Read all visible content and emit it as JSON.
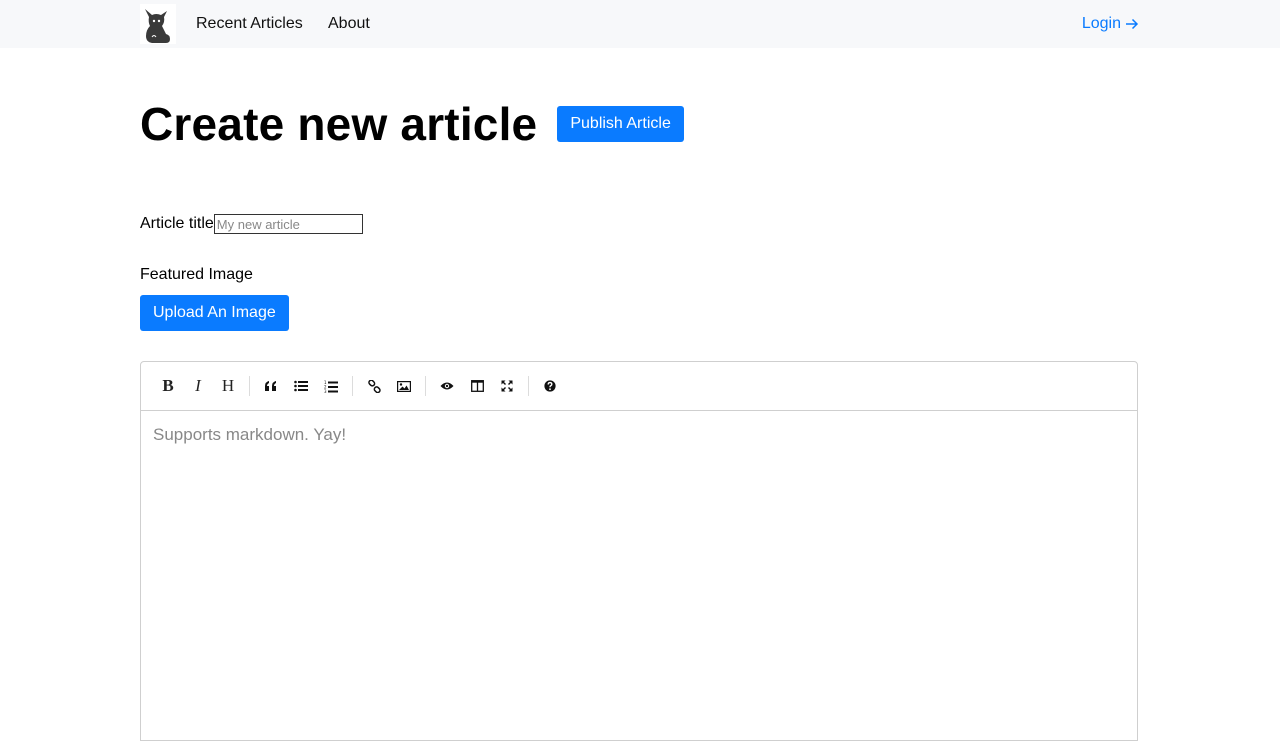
{
  "nav": {
    "logo_name": "cat-logo",
    "links": [
      "Recent Articles",
      "About"
    ],
    "login_label": "Login",
    "login_icon": "arrow-right-icon"
  },
  "page": {
    "title": "Create new article",
    "publish_label": "Publish Article"
  },
  "form": {
    "title_label": "Article title",
    "title_placeholder": "My new article",
    "title_value": "",
    "featured_label": "Featured Image",
    "upload_label": "Upload An Image"
  },
  "editor": {
    "placeholder": "Supports markdown. Yay!",
    "toolbar": {
      "bold": "B",
      "italic": "I",
      "heading": "H",
      "quote": "quote-icon",
      "unordered_list": "unordered-list-icon",
      "ordered_list": "ordered-list-icon",
      "link": "link-icon",
      "image": "image-icon",
      "preview": "eye-icon",
      "side_by_side": "columns-icon",
      "fullscreen": "fullscreen-icon",
      "guide": "question-icon"
    }
  },
  "colors": {
    "accent": "#0a7bff",
    "navbar_bg": "#f7f8fa"
  }
}
